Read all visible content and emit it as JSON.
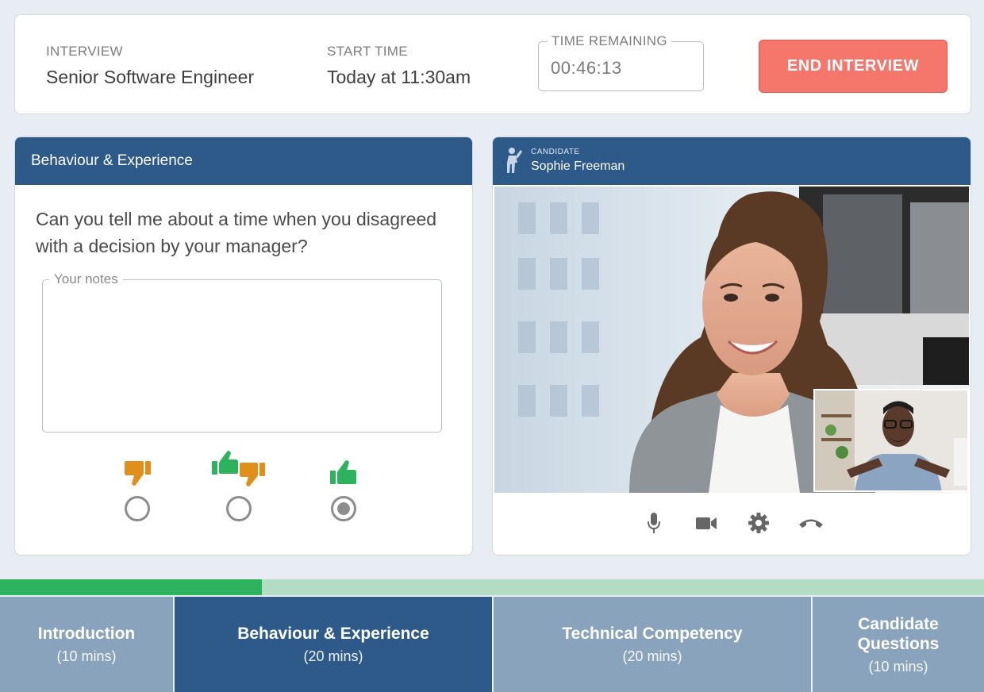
{
  "header": {
    "interview_label": "INTERVIEW",
    "interview_value": "Senior Software Engineer",
    "start_label": "START TIME",
    "start_value": "Today at 11:30am",
    "time_label": "TIME REMAINING",
    "time_value": "00:46:13",
    "end_button": "END INTERVIEW"
  },
  "question_card": {
    "title": "Behaviour & Experience",
    "question": "Can you tell me about a time when you disagreed with a decision by your manager?",
    "notes_label": "Your notes",
    "notes_value": "",
    "ratings": [
      {
        "name": "thumbs-down",
        "selected": false
      },
      {
        "name": "thumbs-mixed",
        "selected": false
      },
      {
        "name": "thumbs-up",
        "selected": true
      }
    ]
  },
  "candidate": {
    "label": "CANDIDATE",
    "name": "Sophie Freeman"
  },
  "controls": [
    "microphone-icon",
    "camera-icon",
    "settings-icon",
    "hang-up-icon"
  ],
  "progress": {
    "fraction": 0.266
  },
  "colors": {
    "brand": "#2e5a8a",
    "tab_inactive": "#8aa3bd",
    "end_button": "#f5776b",
    "progress_fill": "#2db35e",
    "progress_track": "#b2dcc4",
    "thumb_down": "#e0901a",
    "thumb_up": "#2db35e"
  },
  "tabs": [
    {
      "title": "Introduction",
      "duration": "(10 mins)",
      "active": false
    },
    {
      "title": "Behaviour & Experience",
      "duration": "(20 mins)",
      "active": true
    },
    {
      "title": "Technical Competency",
      "duration": "(20 mins)",
      "active": false
    },
    {
      "title": "Candidate Questions",
      "duration": "(10 mins)",
      "active": false
    }
  ]
}
